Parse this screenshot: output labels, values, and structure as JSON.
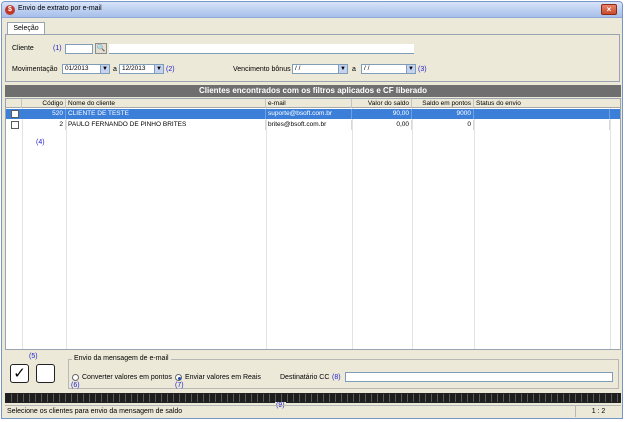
{
  "window": {
    "title": "Envio de extrato por e-mail",
    "close_label": "×"
  },
  "tab": {
    "label": "Seleção"
  },
  "filters": {
    "cliente_label": "Cliente",
    "cliente_marker": "(1)",
    "cliente_code": "",
    "cliente_name": "",
    "movimentacao_label": "Movimentação",
    "mov_from": "01/2013",
    "mov_to": "12/2013",
    "mov_separator": "a",
    "mov_marker": "(2)",
    "vencimento_label": "Vencimento bônus",
    "venc_from": " /  / ",
    "venc_to": " /  / ",
    "venc_separator": "a",
    "venc_marker": "(3)",
    "dropdown_glyph": "▼"
  },
  "grid": {
    "header": "Clientes encontrados com os filtros aplicados e CF liberado",
    "columns": [
      "Código",
      "Nome do cliente",
      "e-mail",
      "Valor do saldo",
      "Saldo em pontos",
      "Status do envio"
    ],
    "rows": [
      {
        "codigo": "520",
        "nome": "CLIENTE DE TESTE",
        "email": "suporte@bsoft.com.br",
        "valor": "90,00",
        "pontos": "9000",
        "status": "",
        "selected": true
      },
      {
        "codigo": "2",
        "nome": "PAULO FERNANDO DE PINHO BRITES",
        "email": "brites@bsoft.com.br",
        "valor": "0,00",
        "pontos": "0",
        "status": "",
        "selected": false
      }
    ],
    "marker": "(4)"
  },
  "actions": {
    "marker": "(5)",
    "check_all_glyph": "✓",
    "uncheck_all_glyph": ""
  },
  "email_options": {
    "group_title": "Envio da mensagem de e-mail",
    "option_points": "Converter valores em pontos",
    "option_points_marker": "(6)",
    "option_reais": "Enviar valores em Reais",
    "option_reais_marker": "(7)",
    "selected": "reais",
    "cc_label": "Destinatário CC",
    "cc_marker": "(8)",
    "cc_value": ""
  },
  "progress": {
    "marker": "(9)"
  },
  "status": {
    "text": "Selecione os clientes para envio da mensagem de saldo",
    "page": "1 : 2"
  }
}
